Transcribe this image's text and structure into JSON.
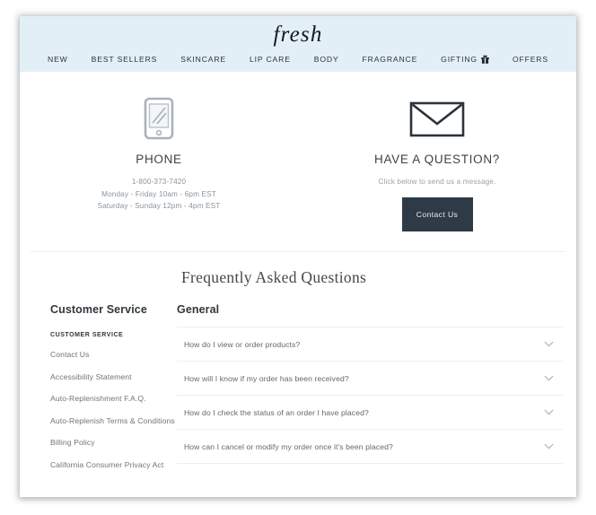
{
  "header": {
    "brand": "fresh",
    "background_color": "#e2eff7",
    "nav": [
      {
        "label": "NEW",
        "icon": null
      },
      {
        "label": "BEST SELLERS",
        "icon": null
      },
      {
        "label": "SKINCARE",
        "icon": null
      },
      {
        "label": "LIP CARE",
        "icon": null
      },
      {
        "label": "BODY",
        "icon": null
      },
      {
        "label": "FRAGRANCE",
        "icon": null
      },
      {
        "label": "GIFTING",
        "icon": "gift-icon"
      },
      {
        "label": "OFFERS",
        "icon": null
      }
    ]
  },
  "contact": {
    "phone": {
      "icon": "smartphone-icon",
      "title": "PHONE",
      "number": "1-800-373-7420",
      "hours_weekday": "Monday - Friday 10am - 6pm EST",
      "hours_weekend": "Saturday - Sunday 12pm - 4pm EST"
    },
    "question": {
      "icon": "envelope-icon",
      "title": "HAVE A QUESTION?",
      "subtitle": "Click below to send us a message.",
      "button_label": "Contact Us",
      "button_color": "#2e3a45"
    }
  },
  "faq": {
    "heading": "Frequently Asked Questions",
    "sidebar": {
      "title": "Customer Service",
      "kicker": "CUSTOMER SERVICE",
      "links": [
        "Contact Us",
        "Accessibility Statement",
        "Auto-Replenishment F.A.Q.",
        "Auto-Replenish Terms & Conditions",
        "Billing Policy",
        "California Consumer Privacy Act"
      ]
    },
    "group_title": "General",
    "questions": [
      "How do I view or order products?",
      "How will I know if my order has been received?",
      "How do I check the status of an order I have placed?",
      "How can I cancel or modify my order once it's been placed?"
    ],
    "expand_icon": "chevron-down-icon"
  }
}
